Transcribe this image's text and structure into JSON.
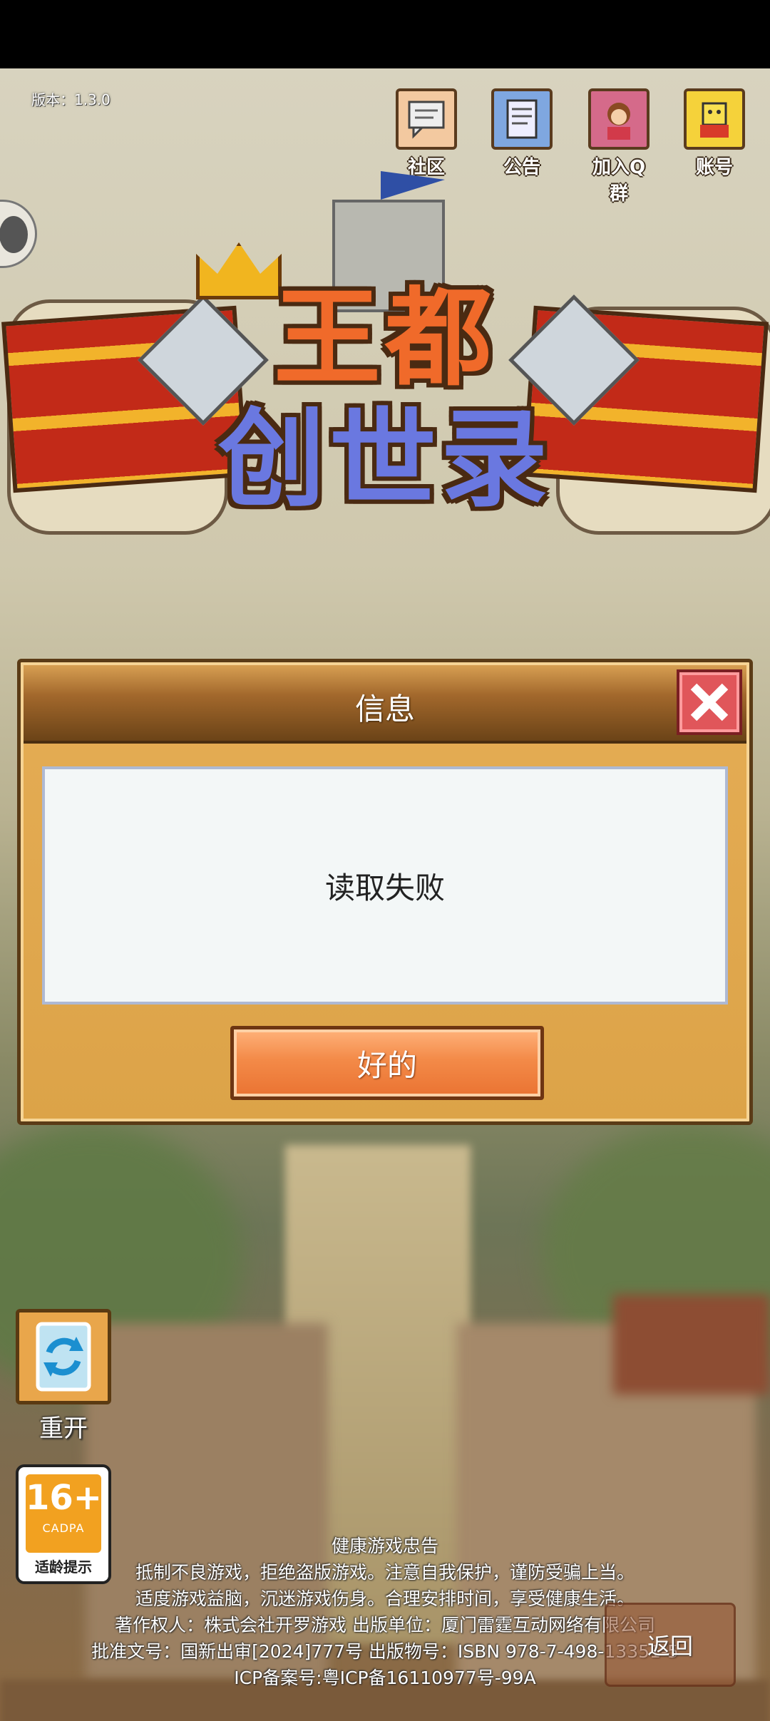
{
  "version": "版本：1.3.0",
  "top_icons": [
    {
      "label": "社区",
      "icon": "chat-icon"
    },
    {
      "label": "公告",
      "icon": "notice-icon"
    },
    {
      "label": "加入Q群",
      "icon": "avatar-icon"
    },
    {
      "label": "账号",
      "icon": "account-icon"
    }
  ],
  "logo": {
    "line1": "王都",
    "line2": "创世录"
  },
  "dialog": {
    "title": "信息",
    "message": "读取失败",
    "ok_label": "好的"
  },
  "restart_label": "重开",
  "age_rating": {
    "number": "16+",
    "org": "CADPA",
    "tip": "适龄提示"
  },
  "footer": {
    "line1": "健康游戏忠告",
    "line2": "抵制不良游戏，拒绝盗版游戏。注意自我保护，谨防受骗上当。",
    "line3": "适度游戏益脑，沉迷游戏伤身。合理安排时间，享受健康生活。",
    "line4": "著作权人：株式会社开罗游戏  出版单位：厦门雷霆互动网络有限公司",
    "line5": "批准文号：国新出审[2024]777号 出版物号：ISBN 978-7-498-13351-5",
    "line6": "ICP备案号:粤ICP备16110977号-99A"
  },
  "back_label": "返回",
  "colors": {
    "dialog_bg": "#e5ad55",
    "ok_button": "#f38a48",
    "close_button": "#e0565a"
  }
}
